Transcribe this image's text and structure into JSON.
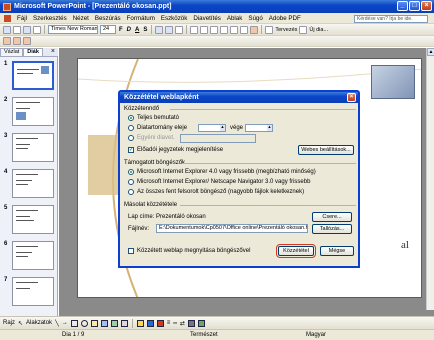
{
  "window": {
    "title": "Microsoft PowerPoint - [Prezentáló okosan.ppt]",
    "buttons": [
      "_",
      "□",
      "×"
    ]
  },
  "menubar": {
    "items": [
      "Fájl",
      "Szerkesztés",
      "Nézet",
      "Beszúrás",
      "Formátum",
      "Eszközök",
      "Diavetítés",
      "Ablak",
      "Súgó",
      "Adobe PDF"
    ],
    "help_placeholder": "Kérdése van? Írja be ide."
  },
  "toolbar": {
    "font": "Times New Roman",
    "font_size": "24",
    "bold": "F",
    "italic": "D",
    "underline": "A",
    "shadow": "S",
    "design_label": "Tervezés",
    "new_slide_label": "Új dia..."
  },
  "panel": {
    "tab_outline": "Vázlat",
    "tab_slides": "Diák",
    "close": "×",
    "slide_numbers": [
      "1",
      "2",
      "3",
      "4",
      "5",
      "6",
      "7"
    ]
  },
  "slide": {
    "visible_text": "al"
  },
  "dialog": {
    "title": "Közzététel weblapként",
    "section_publish": "Közzétenndő",
    "opt_full": "Teljes bemutató",
    "opt_range": "Diatartomány eleje",
    "range_to": "vége",
    "opt_custom": "Egyéni diavet.",
    "speaker_notes": "Előadói jegyzetek megjelenítése",
    "web_options_button": "Webes beállítások...",
    "section_browsers": "Támogatott böngészők",
    "browser_ie4": "Microsoft Internet Explorer 4.0 vagy frissebb (megbízható minőség)",
    "browser_ie3": "Microsoft Internet Explorer/ Netscape Navigator 3.0 vagy frissebb",
    "browser_all": "Az összes fent felsorolt böngésző (nagyobb fájlok keletkeznek)",
    "section_copy": "Másolat közzététele",
    "page_title_label": "Lap címe:",
    "page_title_value": "Prezentáló okosan",
    "change_button": "Csere...",
    "filename_label": "Fájlnév:",
    "filename_value": "E:\\Dokumentumok\\Cp0507\\Office online\\Prezentáló okosan.htm",
    "browse_button": "Tallózás...",
    "open_in_browser": "Közzétett weblap megnyitása böngészővel",
    "publish_button": "Közzététel",
    "cancel_button": "Mégse"
  },
  "drawbar": {
    "draw_label": "Rajz",
    "autoshapes_label": "Alakzatok"
  },
  "statusbar": {
    "slide_info": "Dia 1 / 9",
    "design": "Természet",
    "language": "Magyar"
  },
  "colors": {
    "titlebar": "#0a46c8",
    "dialog_border": "#0b3fd1",
    "highlight": "#d23a1a"
  }
}
